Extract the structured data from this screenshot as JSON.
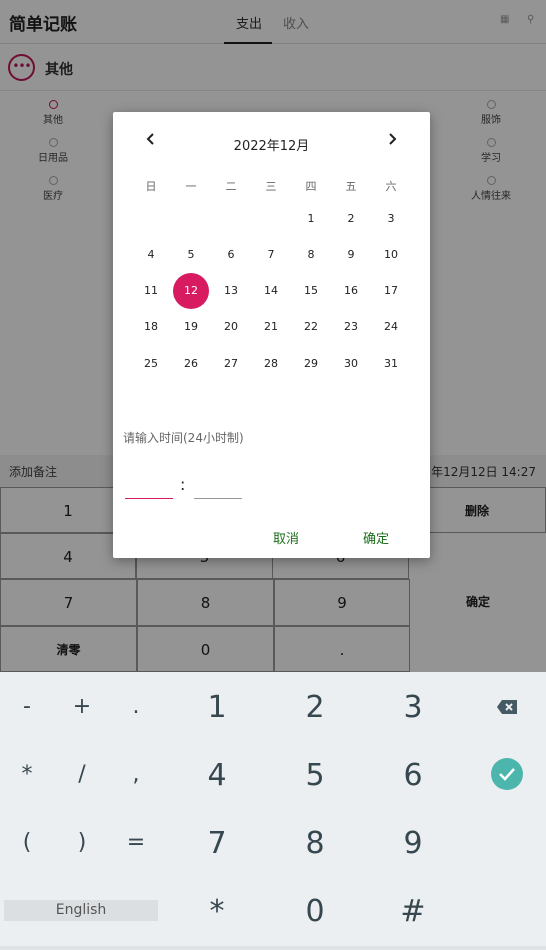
{
  "app": {
    "title": "简单记账",
    "tabs": [
      "支出",
      "收入"
    ],
    "icons": [
      "grid-icon",
      "search-icon"
    ]
  },
  "category_header": {
    "icon_text": "•••",
    "name": "其他"
  },
  "categories": [
    {
      "label": "其他"
    },
    {
      "label": "服饰"
    },
    {
      "label": "日用品"
    },
    {
      "label": "学习"
    },
    {
      "label": "医疗"
    },
    {
      "label": "人情往来"
    }
  ],
  "note_bar": {
    "placeholder": "添加备注",
    "date_text": "年12月12日 14:27"
  },
  "keypad": {
    "keys": [
      "1",
      "删除",
      "4",
      "5",
      "6",
      "7",
      "8",
      "9",
      "确定",
      "清零",
      "0",
      "."
    ]
  },
  "dialog": {
    "month": "2022年12月",
    "prev": "‹",
    "next": "›",
    "weekdays": [
      "日",
      "一",
      "二",
      "三",
      "四",
      "五",
      "六"
    ],
    "weeks": [
      [
        "",
        "",
        "",
        "",
        "1",
        "2",
        "3"
      ],
      [
        "4",
        "5",
        "6",
        "7",
        "8",
        "9",
        "10"
      ],
      [
        "11",
        "12",
        "13",
        "14",
        "15",
        "16",
        "17"
      ],
      [
        "18",
        "19",
        "20",
        "21",
        "22",
        "23",
        "24"
      ],
      [
        "25",
        "26",
        "27",
        "28",
        "29",
        "30",
        "31"
      ]
    ],
    "selected_day": "12",
    "time_prompt": "请输入时间(24小时制)",
    "time_separator": ":",
    "hour_value": "",
    "minute_value": "",
    "cancel": "取消",
    "ok": "确定"
  },
  "keyboard": {
    "rows": [
      [
        "-",
        "+",
        ".",
        "1",
        "2",
        "3"
      ],
      [
        "*",
        "/",
        ",",
        "4",
        "5",
        "6"
      ],
      [
        "(",
        ")",
        "=",
        "7",
        "8",
        "9"
      ],
      [
        "*",
        "0",
        "#"
      ]
    ],
    "english": "English"
  },
  "colors": {
    "accent": "#d81b60",
    "dialog_button": "#1b6e1b",
    "keyboard_bg": "#eceff1",
    "done_key": "#4db6ac"
  }
}
